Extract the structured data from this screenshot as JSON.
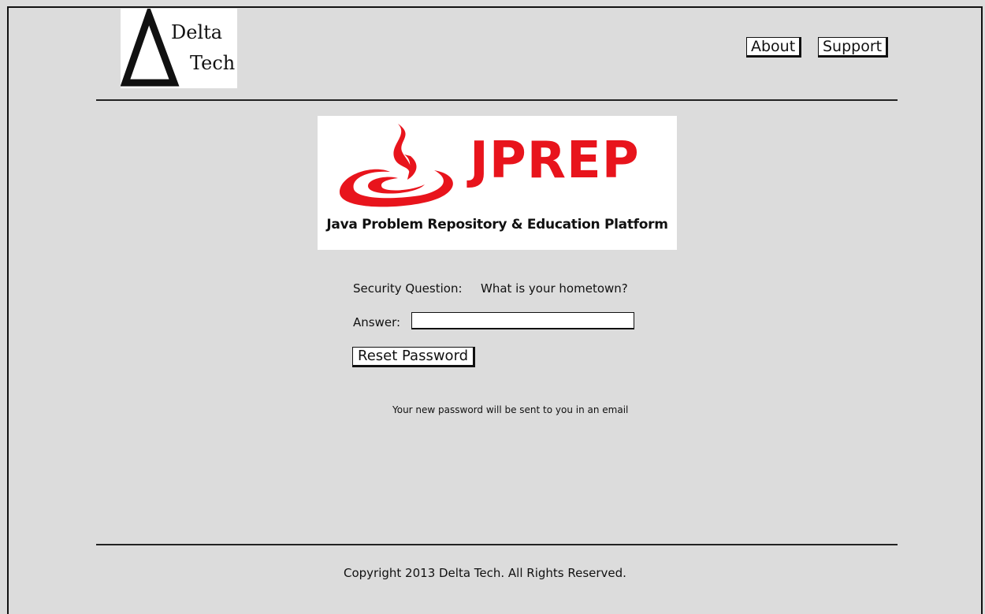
{
  "company_logo": {
    "line1": "Delta",
    "line2": "Tech"
  },
  "nav": {
    "about_label": "About",
    "support_label": "Support"
  },
  "app_logo": {
    "title": "JPREP",
    "subtitle": "Java Problem Repository & Education Platform",
    "brand_color": "#e8141c"
  },
  "form": {
    "security_question_label": "Security Question:",
    "security_question": "What is your hometown?",
    "answer_label": "Answer:",
    "answer_value": "",
    "reset_button_label": "Reset Password",
    "info_text": "Your new password will be sent to you in an email"
  },
  "footer": {
    "copyright": "Copyright 2013 Delta Tech. All Rights Reserved."
  },
  "colors": {
    "background": "#dcdcdc",
    "ink": "#111111"
  }
}
